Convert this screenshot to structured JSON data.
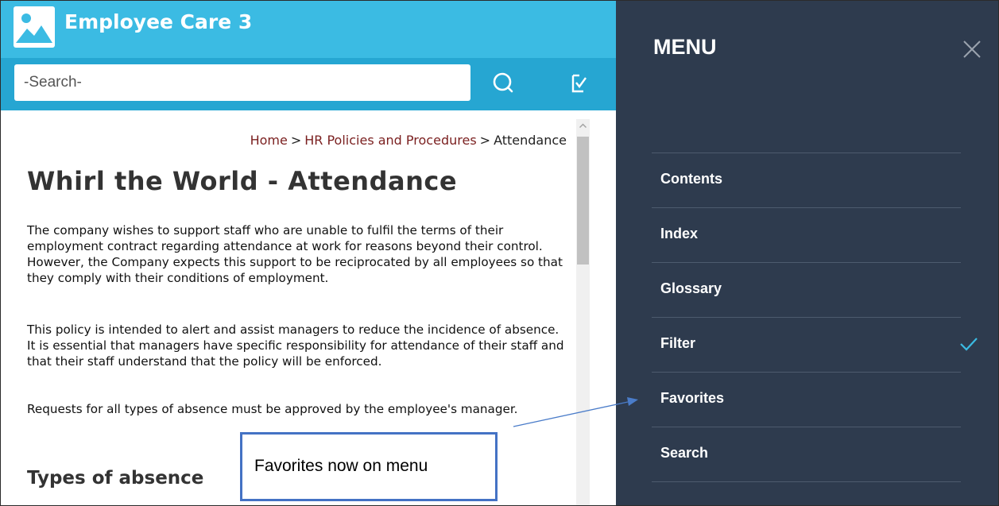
{
  "app": {
    "title": "Employee Care 3"
  },
  "search": {
    "placeholder": "-Search-"
  },
  "breadcrumb": {
    "home": "Home",
    "separator": ">",
    "section": "HR Policies and Procedures",
    "current": "Attendance"
  },
  "page": {
    "title": "Whirl the World - Attendance",
    "paragraphs": [
      "The company wishes to support staff who are unable to fulfil the terms of their employment contract regarding attendance at work for reasons beyond their control. However, the Company expects this support to be reciprocated by all employees so that they comply with their conditions of employment.",
      "This policy is intended to alert and assist managers to reduce the incidence of absence. It is essential that managers have specific responsibility for attendance of their staff and that their staff understand that the policy will be enforced.",
      "Requests for all types of absence must be approved by the employee's manager."
    ],
    "section_heading": "Types of absence"
  },
  "menu": {
    "title": "MENU",
    "items": [
      {
        "label": "Contents"
      },
      {
        "label": "Index"
      },
      {
        "label": "Glossary"
      },
      {
        "label": "Filter",
        "checked": true
      },
      {
        "label": "Favorites"
      },
      {
        "label": "Search"
      }
    ]
  },
  "annotation": {
    "text": "Favorites now on menu"
  },
  "colors": {
    "header": "#3bbbe3",
    "searchbar": "#26a6d2",
    "menu_bg": "#2e3b4e",
    "breadcrumb_link": "#7a1f1f",
    "callout_border": "#4472c4",
    "check": "#3bbbe3"
  },
  "icons": {
    "logo": "image-icon",
    "search": "search-icon",
    "filter": "filter-check-icon",
    "close": "close-icon",
    "check": "check-icon"
  }
}
